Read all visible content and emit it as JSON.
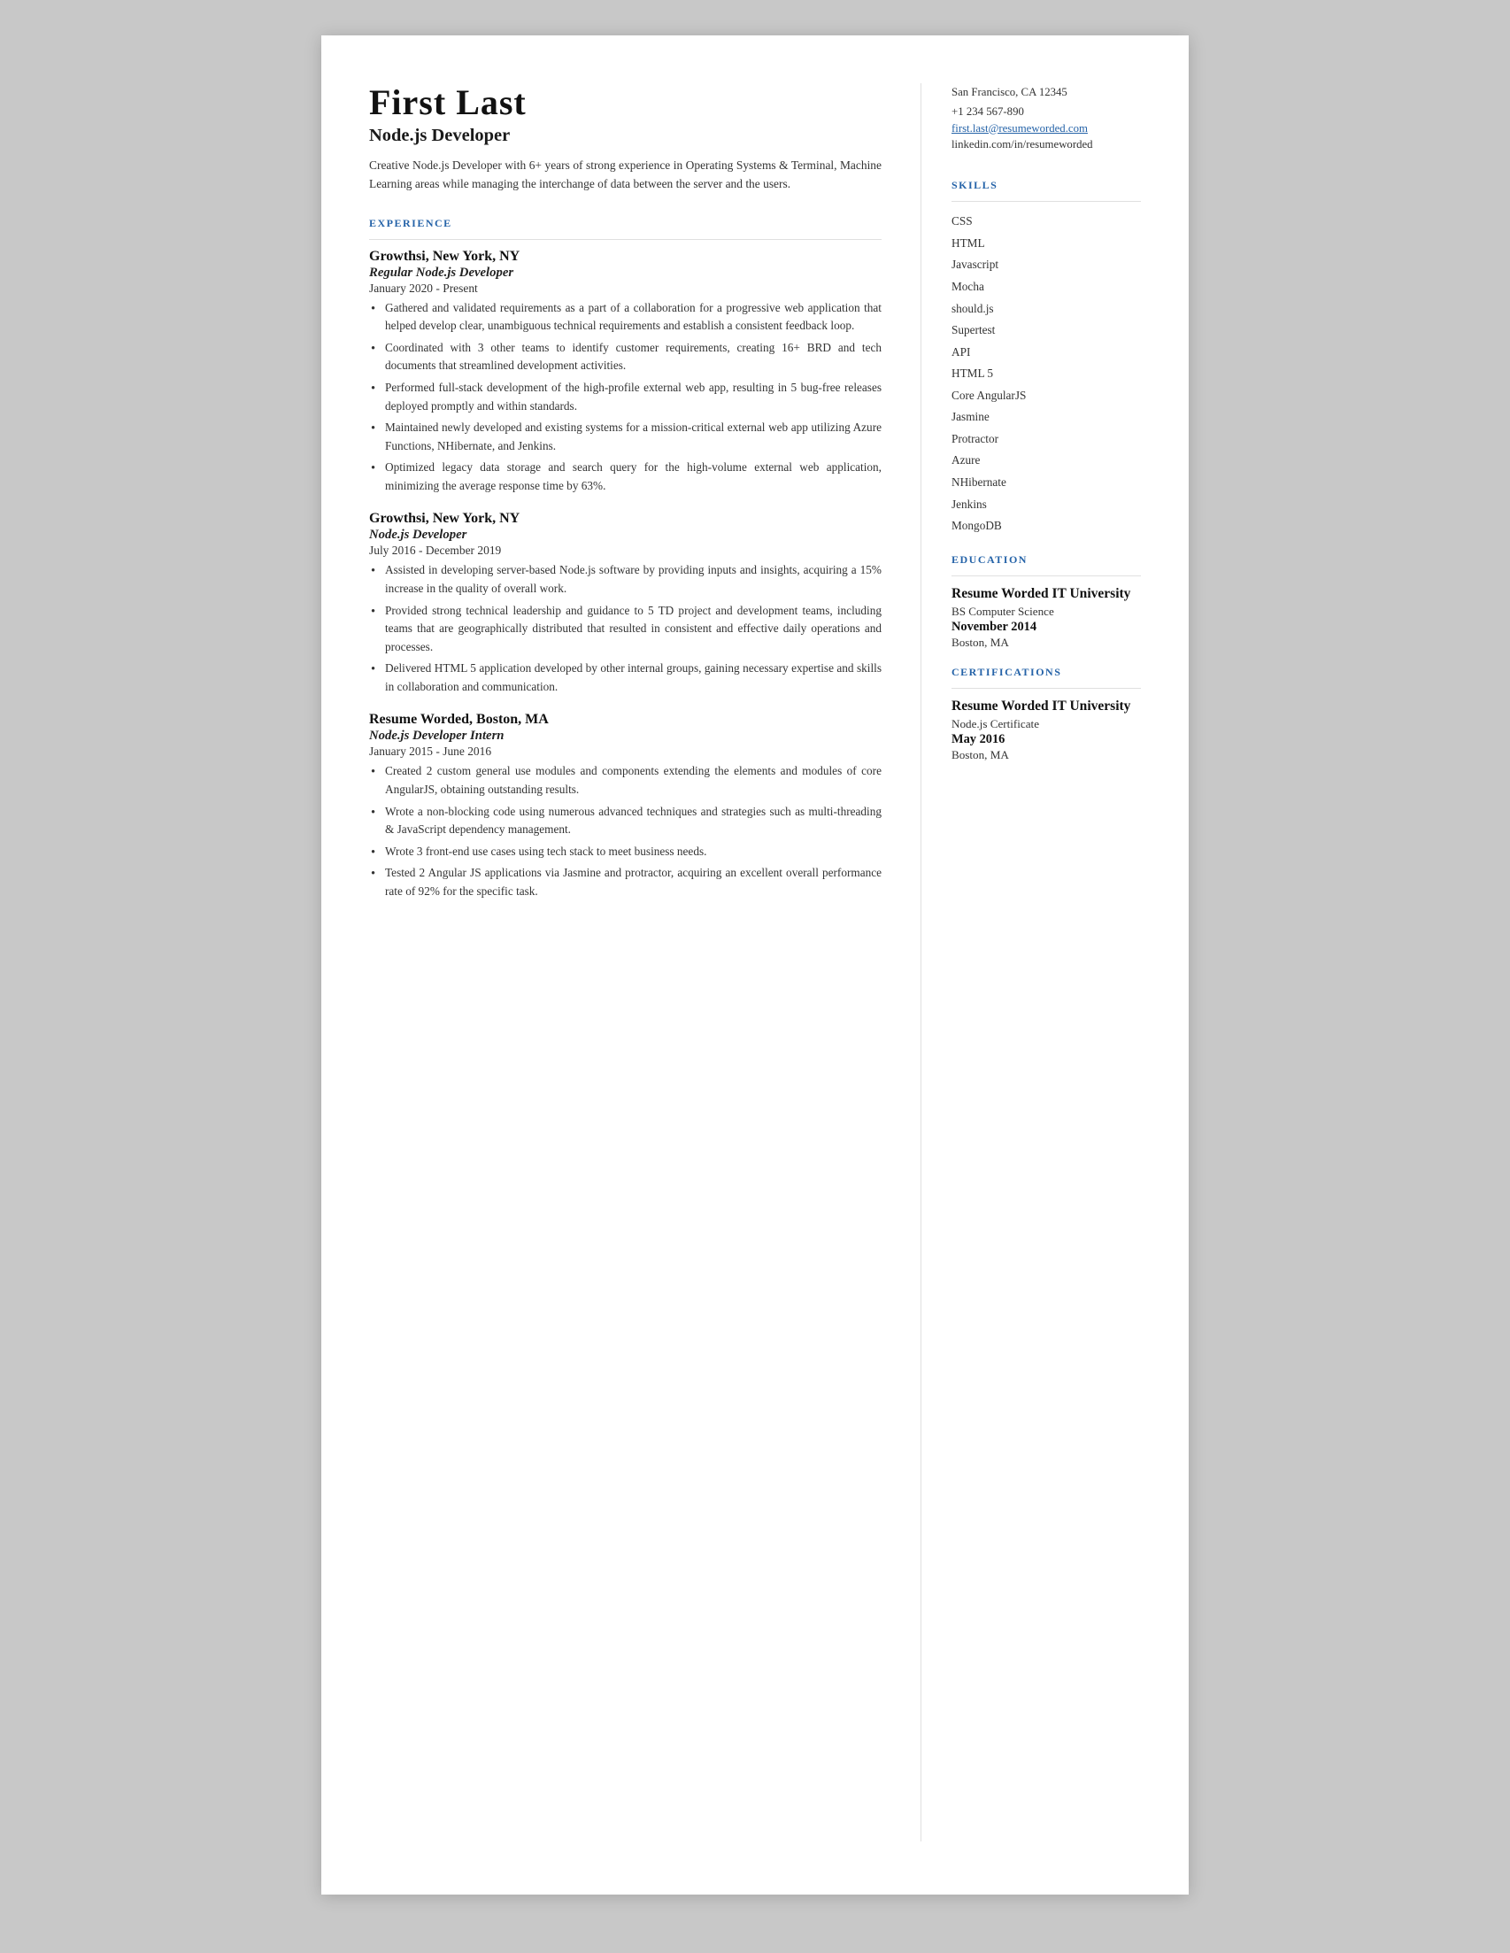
{
  "header": {
    "name": "First Last",
    "title": "Node.js Developer",
    "summary": "Creative Node.js Developer with 6+ years of strong experience in Operating Systems & Terminal, Machine Learning areas while managing the interchange of data between the server and the users."
  },
  "contact": {
    "address": "San Francisco, CA 12345",
    "phone": "+1 234 567-890",
    "email": "first.last@resumeworded.com",
    "linkedin": "linkedin.com/in/resumeworded"
  },
  "sections": {
    "experience_label": "EXPERIENCE",
    "skills_label": "SKILLS",
    "education_label": "EDUCATION",
    "certifications_label": "CERTIFICATIONS"
  },
  "jobs": [
    {
      "company": "Growthsi,",
      "location": "New York, NY",
      "role": "Regular Node.js Developer",
      "dates": "January 2020 - Present",
      "bullets": [
        "Gathered and validated requirements as a part of a collaboration for a progressive web application that helped develop clear, unambiguous technical requirements and establish a consistent feedback loop.",
        "Coordinated with 3 other teams to identify customer requirements, creating 16+ BRD and tech documents that streamlined development activities.",
        "Performed full-stack development of the high-profile external web app, resulting in 5 bug-free releases deployed promptly and within standards.",
        "Maintained newly developed and existing systems for a mission-critical external web app utilizing Azure Functions, NHibernate, and Jenkins.",
        "Optimized legacy data storage and search query for the high-volume external web application, minimizing the average response time by 63%."
      ]
    },
    {
      "company": "Growthsi,",
      "location": "New York, NY",
      "role": "Node.js Developer",
      "dates": "July 2016 - December 2019",
      "bullets": [
        "Assisted in developing server-based Node.js software by providing inputs and insights, acquiring a 15% increase in the quality of overall work.",
        "Provided strong technical leadership and guidance to 5 TD project and development teams, including teams that are geographically distributed that resulted in consistent and effective daily operations and processes.",
        "Delivered HTML 5 application developed by other internal groups, gaining necessary expertise and skills in collaboration and communication."
      ]
    },
    {
      "company": "Resume Worded,",
      "location": "Boston, MA",
      "role": "Node.js Developer Intern",
      "dates": "January 2015 - June 2016",
      "bullets": [
        "Created 2 custom general use modules and components extending the elements and modules of core AngularJS, obtaining outstanding results.",
        "Wrote a non-blocking code using numerous advanced techniques and strategies such as multi-threading & JavaScript dependency management.",
        "Wrote 3 front-end use cases using tech stack to meet business needs.",
        "Tested 2 Angular JS applications via Jasmine and protractor, acquiring an excellent overall performance rate of 92% for the specific task."
      ]
    }
  ],
  "skills": [
    "CSS",
    "HTML",
    "Javascript",
    "Mocha",
    "should.js",
    "Supertest",
    "API",
    "HTML 5",
    "Core AngularJS",
    "Jasmine",
    "Protractor",
    "Azure",
    "NHibernate",
    "Jenkins",
    "MongoDB"
  ],
  "education": {
    "school": "Resume Worded IT University",
    "degree": "BS Computer Science",
    "date": "November 2014",
    "location": "Boston, MA"
  },
  "certification": {
    "school": "Resume Worded IT University",
    "cert": "Node.js Certificate",
    "date": "May 2016",
    "location": "Boston, MA"
  }
}
